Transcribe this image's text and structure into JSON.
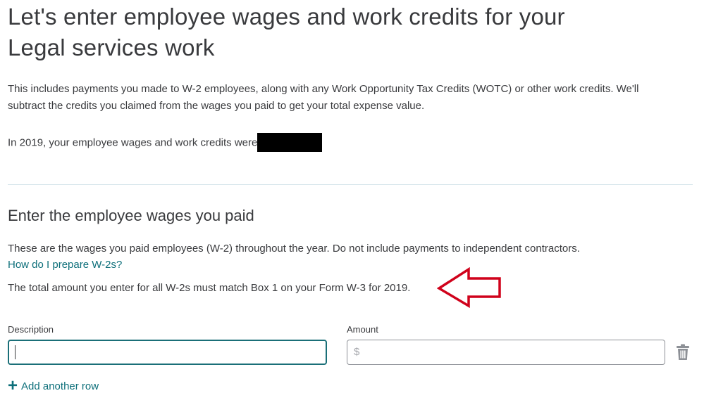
{
  "header": {
    "title_line1": "Let's enter employee wages and work credits for your",
    "title_line2": "Legal services work"
  },
  "intro": {
    "text": "This includes payments you made to W-2 employees, along with any Work Opportunity Tax Credits (WOTC) or other work credits. We'll subtract the credits you claimed from the wages you paid to get your total expense value."
  },
  "prior_year": {
    "text": "In 2019, your employee wages and work credits were"
  },
  "wages_section": {
    "title": "Enter the employee wages you paid",
    "description": "These are the wages you paid employees (W-2) throughout the year. Do not include payments to independent contractors.",
    "help_link": "How do I prepare W-2s?",
    "note": "The total amount you enter for all W-2s must match Box 1 on your Form W-3 for 2019."
  },
  "form": {
    "description_label": "Description",
    "description_value": "",
    "amount_label": "Amount",
    "amount_currency": "$",
    "amount_value": "",
    "add_row_label": "Add another row"
  },
  "icons": {
    "delete": "trash-icon",
    "add": "plus-icon",
    "annotation": "arrow-left-icon"
  },
  "colors": {
    "link": "#0d6f7a",
    "focus_border": "#1a6f78",
    "annotation_arrow": "#d0021b",
    "text": "#393a3d"
  }
}
